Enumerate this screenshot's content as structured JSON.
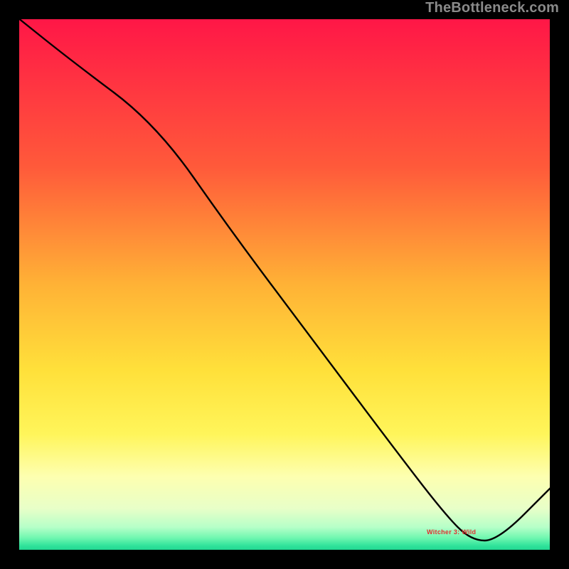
{
  "watermark": "TheBottleneck.com",
  "bottom_label": "Witcher 3: Wild",
  "chart_data": {
    "type": "line",
    "title": "",
    "xlabel": "",
    "ylabel": "",
    "xlim": [
      0,
      100
    ],
    "ylim": [
      0,
      100
    ],
    "background_gradient": {
      "stops": [
        {
          "offset": 0,
          "color": "#ff1647"
        },
        {
          "offset": 0.28,
          "color": "#ff5a3a"
        },
        {
          "offset": 0.5,
          "color": "#ffb236"
        },
        {
          "offset": 0.66,
          "color": "#ffe03a"
        },
        {
          "offset": 0.78,
          "color": "#fff55a"
        },
        {
          "offset": 0.86,
          "color": "#fdffb0"
        },
        {
          "offset": 0.92,
          "color": "#e8ffc8"
        },
        {
          "offset": 0.955,
          "color": "#b6ffc8"
        },
        {
          "offset": 0.975,
          "color": "#70f7b0"
        },
        {
          "offset": 0.99,
          "color": "#2fe29a"
        },
        {
          "offset": 1.0,
          "color": "#1fd590"
        }
      ]
    },
    "series": [
      {
        "name": "curve",
        "x": [
          0,
          10,
          26,
          40,
          55,
          70,
          80,
          85,
          90,
          100
        ],
        "y": [
          100,
          92,
          80,
          60,
          40,
          20,
          7,
          2,
          2,
          12
        ]
      }
    ],
    "label_position_x": 82,
    "label_position_y": 3.5
  }
}
